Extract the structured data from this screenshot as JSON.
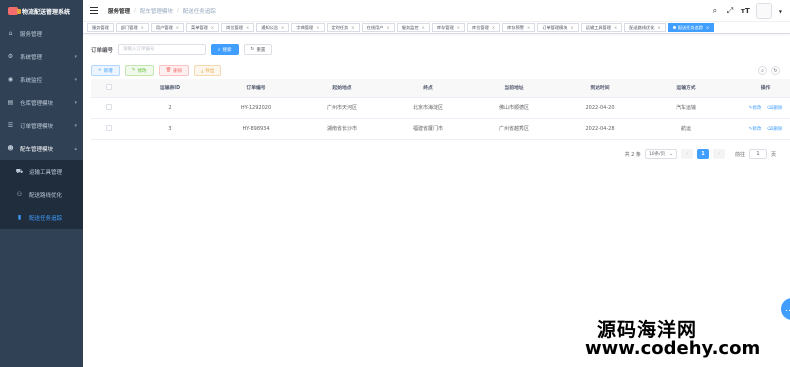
{
  "app": {
    "title": "物流配送管理系统"
  },
  "sidebar": {
    "items": [
      {
        "label": "服务管理",
        "icon": "home-icon"
      },
      {
        "label": "系统管理",
        "icon": "gear-icon",
        "arrow": "▾"
      },
      {
        "label": "系统监控",
        "icon": "monitor-icon",
        "arrow": "▾"
      },
      {
        "label": "仓库管理模块",
        "icon": "warehouse-icon",
        "arrow": "▾"
      },
      {
        "label": "订单管理模块",
        "icon": "order-icon",
        "arrow": "▾"
      },
      {
        "label": "配车管理模块",
        "icon": "user-icon",
        "arrow": "▴"
      }
    ],
    "sub": [
      {
        "label": "运输工具管理",
        "icon": "truck-icon"
      },
      {
        "label": "配送路线优化",
        "icon": "route-icon"
      },
      {
        "label": "配送任务追踪",
        "icon": "chart-icon",
        "active": true
      }
    ]
  },
  "breadcrumb": [
    "服务管理",
    "配车管理模块",
    "配送任务追踪"
  ],
  "tags": [
    "服务管理",
    "部门管理",
    "用户管理",
    "菜单管理",
    "岗位管理",
    "通知公告",
    "字典管理",
    "定时任务",
    "在线用户",
    "服务监控",
    "库存管理",
    "库位管理",
    "库存预警",
    "订单管理模块",
    "运输工具管理",
    "配送路线优化",
    "配送任务追踪"
  ],
  "search": {
    "label": "订单编号",
    "placeholder": "请输入订单编号",
    "search_btn": "搜索",
    "reset_btn": "重置"
  },
  "toolbar": {
    "add": "新增",
    "edit": "修改",
    "delete": "删除",
    "export": "导出"
  },
  "table": {
    "columns": [
      "运输表ID",
      "订单编号",
      "起始地点",
      "终点",
      "当前地址",
      "到达时间",
      "运输方式",
      "操作"
    ],
    "rows": [
      {
        "id": "2",
        "order": "HY-1292020",
        "start": "广州市天河区",
        "end": "北京市海淀区",
        "current": "佛山市顺德区",
        "arrive": "2022-04-20",
        "method": "汽车运输"
      },
      {
        "id": "3",
        "order": "HY-898934",
        "start": "湖南省长沙市",
        "end": "福建省厦门市",
        "current": "广州省越秀区",
        "arrive": "2022-04-28",
        "method": "航运"
      }
    ],
    "op_edit": "修改",
    "op_delete": "删除"
  },
  "pagination": {
    "total": "共 2 条",
    "page_size": "10条/页",
    "current_page": "1",
    "goto_label": "前往",
    "goto_value": "1",
    "page_unit": "页"
  },
  "watermark": {
    "line1": "源码海洋网",
    "line2": "www.codehy.com"
  },
  "colors": {
    "primary": "#409eff",
    "sidebar": "#304156"
  }
}
